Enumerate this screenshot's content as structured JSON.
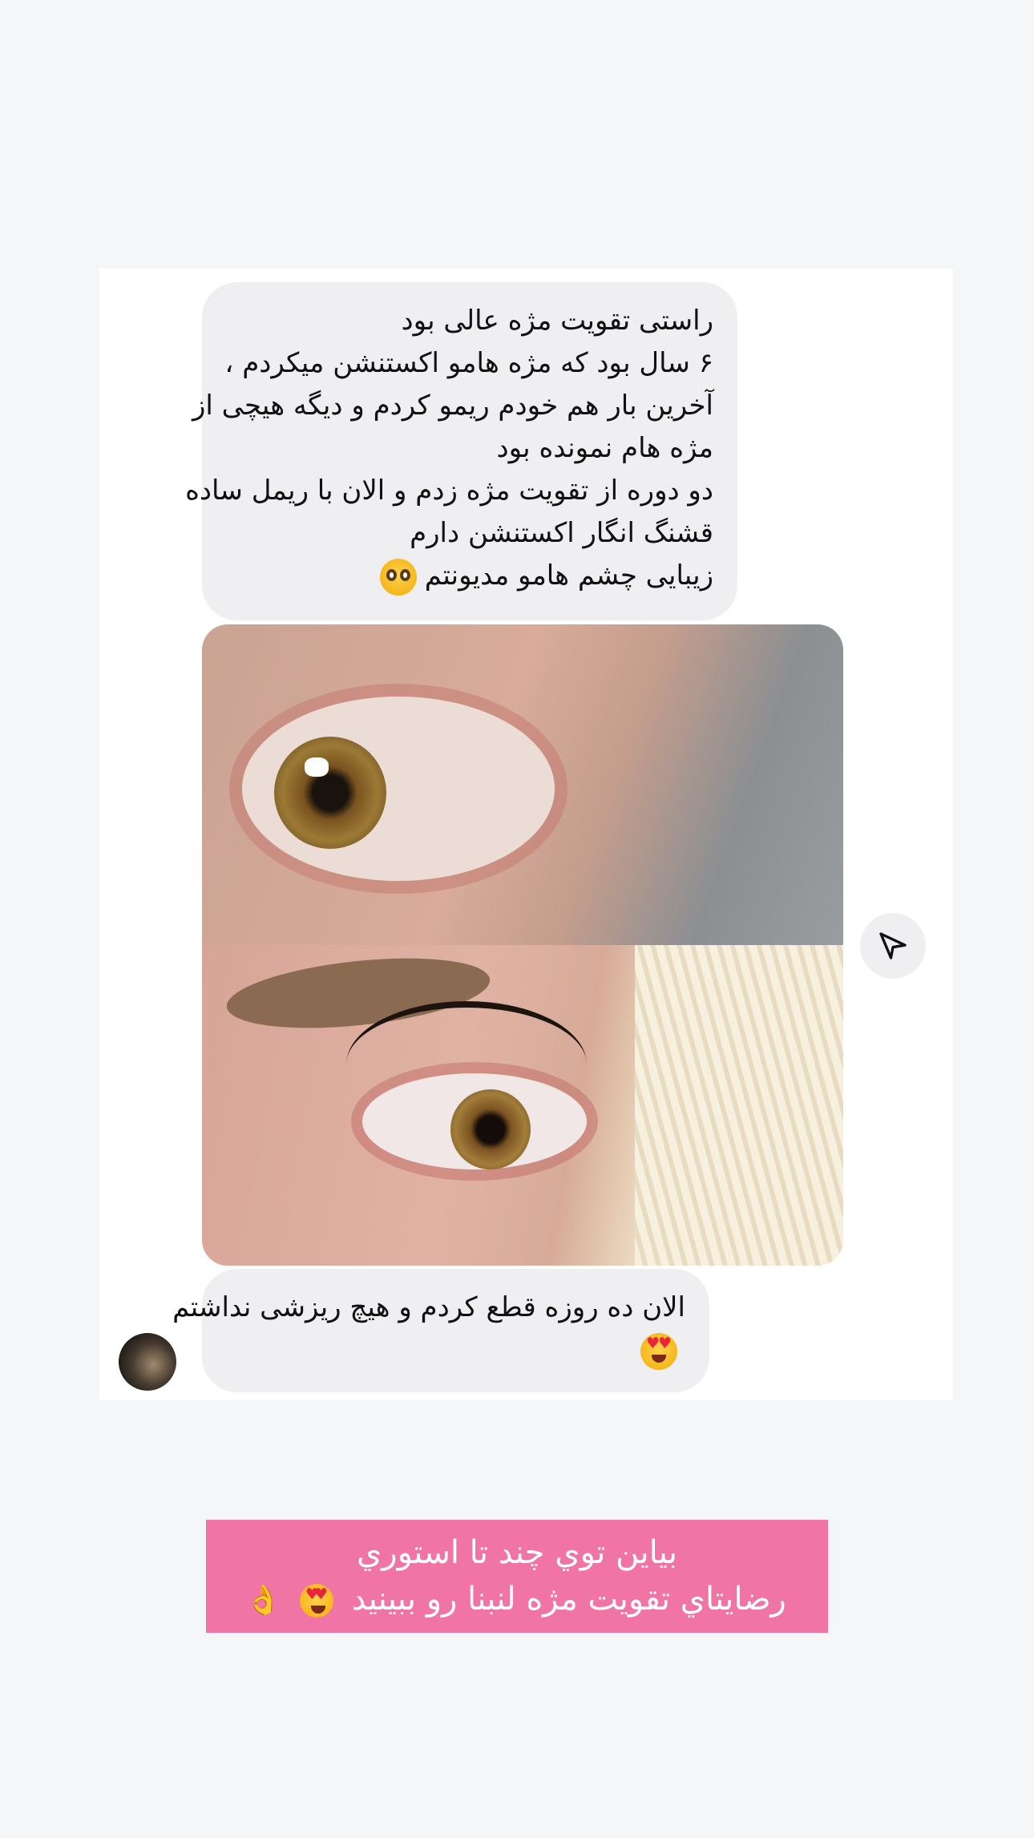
{
  "message_bubble_1": {
    "lines": [
      "راستی تقویت مژه عالی بود",
      "۶ سال بود که مژه هامو اکستنشن میکردم ،",
      "آخرین بار هم خودم ریمو کردم و دیگه هیچی از",
      "مژه هام نمونده بود",
      "دو دوره از تقویت مژه زدم و الان با ریمل ساده",
      "قشنگ انگار اکستنشن دارم",
      "زیبایی چشم هامو مدیونتم"
    ],
    "emoji": "pleading-face-emoji"
  },
  "photo": {
    "top_label": "before-eye-photo",
    "bottom_label": "after-eye-photo"
  },
  "share": {
    "icon": "paper-plane-icon"
  },
  "message_bubble_2": {
    "lines": [
      "الان ده روزه قطع کردم و هیچ ریزشی نداشتم"
    ],
    "emoji": "heart-eyes-emoji"
  },
  "avatar": {
    "icon": "sender-avatar"
  },
  "caption": {
    "line1": "بیاین توي چند تا استوري",
    "line2": "رضایتاي تقویت مژه لنبنا رو ببینید",
    "emojis": [
      "heart-eyes-emoji",
      "ok-hand-emoji"
    ],
    "background": "#f075a4",
    "text_color": "#ffffff"
  },
  "colors": {
    "page_background": "#f5f6f8",
    "card_background": "#ffffff",
    "bubble_background": "#efeff1"
  }
}
